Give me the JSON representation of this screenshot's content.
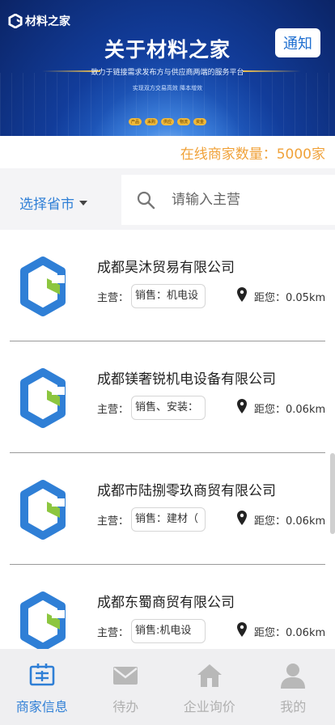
{
  "banner": {
    "brand": "材料之家",
    "title": "关于材料之家",
    "subtitle": "致力于链接需求发布方与供应商两端的服务平台",
    "slogan": "实现双方交易高效 降本增效",
    "tags": [
      "产品",
      "采购",
      "供应",
      "物流",
      "资金"
    ],
    "notify_label": "通知"
  },
  "merchant_count": "在线商家数量：5000家",
  "filter": {
    "province_label": "选择省市",
    "search_placeholder": "请输入主营"
  },
  "companies": [
    {
      "name": "成都昊沐贸易有限公司",
      "biz_label": "主营：",
      "biz": "销售：机电设",
      "distance": "距您：0.05km"
    },
    {
      "name": "成都镁奢锐机电设备有限公司",
      "biz_label": "主营：",
      "biz": "销售、安装：",
      "distance": "距您：0.06km"
    },
    {
      "name": "成都市陆捌零玖商贸有限公司",
      "biz_label": "主营：",
      "biz": "销售：建材（",
      "distance": "距您：0.06km"
    },
    {
      "name": "成都东蜀商贸有限公司",
      "biz_label": "主营：",
      "biz": "销售:机电设",
      "distance": "距您：0.06km"
    }
  ],
  "tabs": [
    {
      "label": "商家信息",
      "icon": "merchant-info-icon",
      "active": true
    },
    {
      "label": "待办",
      "icon": "mail-icon",
      "active": false
    },
    {
      "label": "企业询价",
      "icon": "home-icon",
      "active": false
    },
    {
      "label": "我的",
      "icon": "user-icon",
      "active": false
    }
  ],
  "colors": {
    "accent": "#2f7fd6",
    "count": "#f0a23a",
    "logo_blue": "#2f7fd6",
    "logo_green": "#8cc63f"
  }
}
